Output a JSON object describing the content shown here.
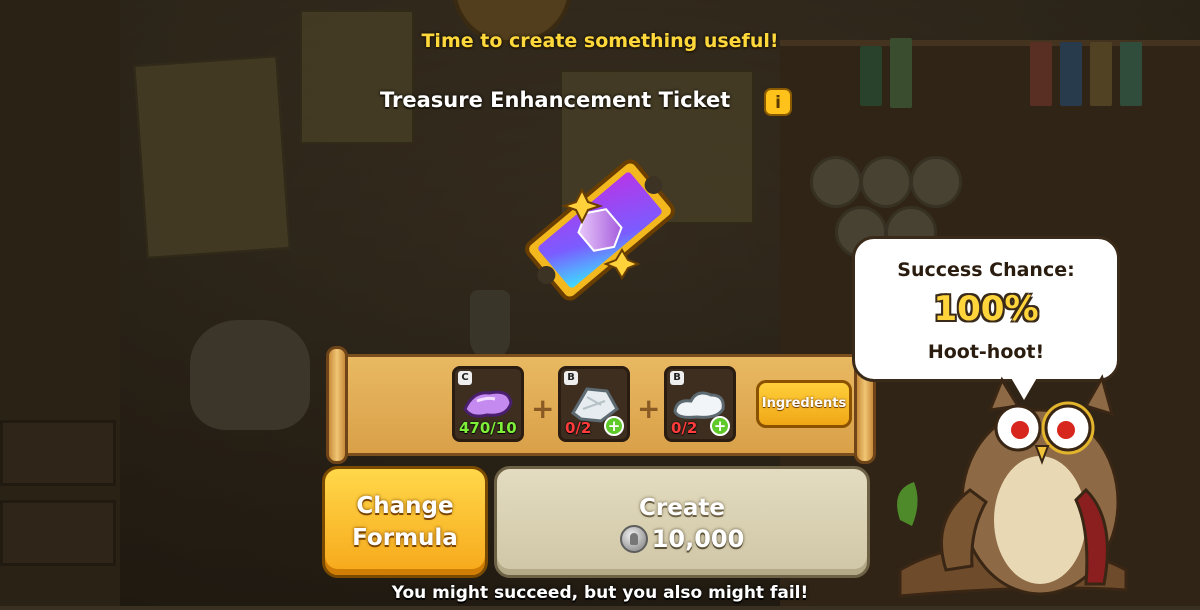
{
  "header": {
    "prompt": "Time to create something useful!",
    "item_title": "Treasure Enhancement Ticket",
    "info_icon": "i"
  },
  "ingredients": [
    {
      "name": "purple-crystal",
      "grade": "C",
      "count": "470/10",
      "count_color": "#7ef03a"
    },
    {
      "name": "silver-powder",
      "grade": "B",
      "count": "0/2",
      "count_color": "#ff3b3b"
    },
    {
      "name": "silver-dough",
      "grade": "B",
      "count": "0/2",
      "count_color": "#ff3b3b"
    }
  ],
  "buttons": {
    "ingredients": "Ingredients",
    "change_line1": "Change",
    "change_line2": "Formula",
    "create": "Create",
    "create_cost": "10,000"
  },
  "bubble": {
    "line1": "Success Chance:",
    "line2": "100%",
    "line3": "Hoot-hoot!"
  },
  "footer": "You might succeed, but you also might fail!",
  "icons": {
    "info": "info-icon",
    "ticket": "treasure-ticket-icon",
    "coin": "coin-icon",
    "add": "add-plus-icon",
    "owl": "owl-character"
  },
  "colors": {
    "accent_yellow": "#ffd93b",
    "button_orange": "#f6a81a",
    "create_disabled": "#d8cfb0"
  }
}
